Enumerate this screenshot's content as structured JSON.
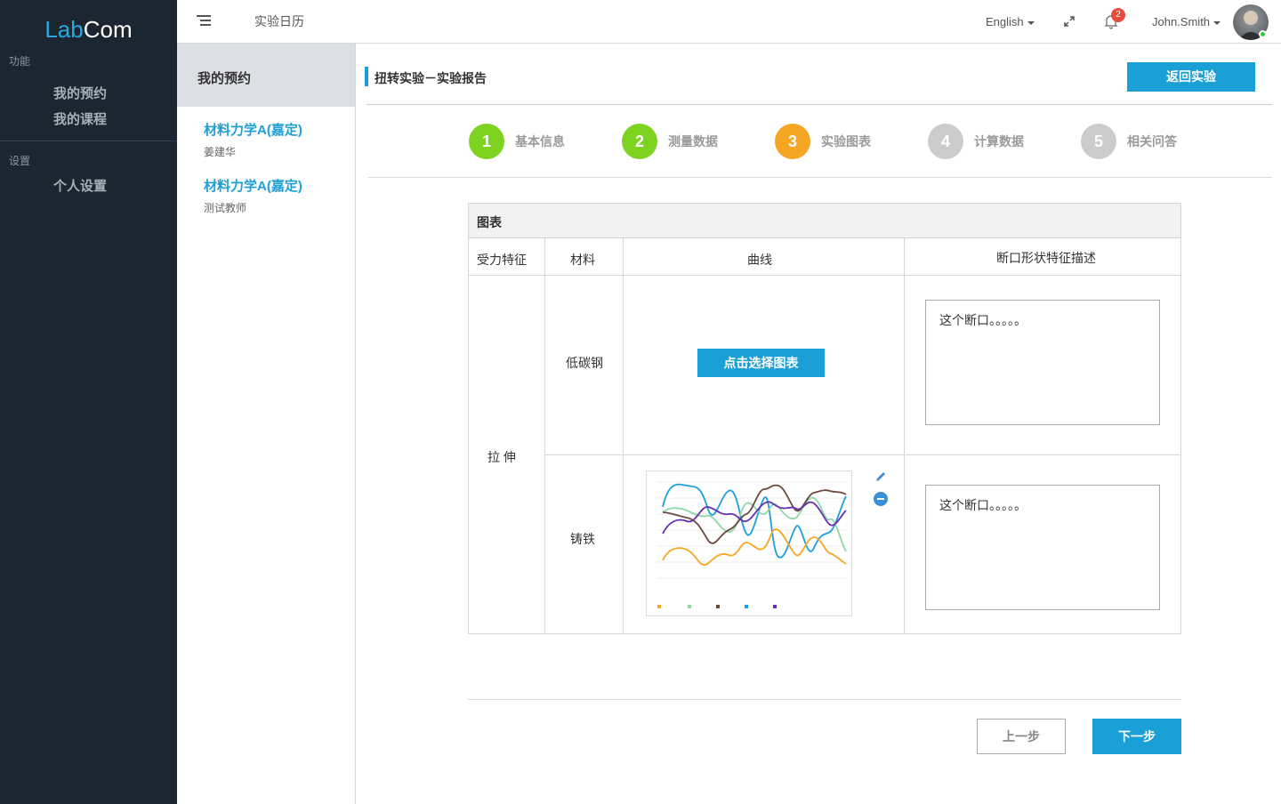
{
  "app": {
    "logo_lab": "Lab",
    "logo_com": "Com"
  },
  "sidebar": {
    "section_function": "功能",
    "items_function": [
      "我的预约",
      "我的课程"
    ],
    "section_settings": "设置",
    "items_settings": [
      "个人设置"
    ]
  },
  "topbar": {
    "calendar_link": "实验日历",
    "language": "English",
    "notification_count": "2",
    "username": "John.Smith"
  },
  "panel": {
    "header": "我的预约",
    "courses": [
      {
        "title": "材料力学A(嘉定)",
        "teacher": "姜建华"
      },
      {
        "title": "材料力学A(嘉定)",
        "teacher": "测试教师"
      }
    ]
  },
  "main": {
    "title": "扭转实验－实验报告",
    "back_button": "返回实验",
    "steps": [
      {
        "num": "1",
        "label": "基本信息",
        "color": "#7ed321"
      },
      {
        "num": "2",
        "label": "测量数据",
        "color": "#7ed321"
      },
      {
        "num": "3",
        "label": "实验图表",
        "color": "#f5a623"
      },
      {
        "num": "4",
        "label": "计算数据",
        "color": "#cccccc"
      },
      {
        "num": "5",
        "label": "相关问答",
        "color": "#cccccc"
      }
    ],
    "table": {
      "caption": "图表",
      "headers": [
        "受力特征",
        "材料",
        "曲线",
        "断口形状特征描述"
      ],
      "force": "拉 伸",
      "rows": [
        {
          "material": "低碳钢",
          "chart_button": "点击选择图表",
          "description": "这个断口。。。。。"
        },
        {
          "material": "铸铁",
          "description": "这个断口。。。。。"
        }
      ]
    },
    "prev_button": "上一步",
    "next_button": "下一步"
  },
  "colors": {
    "accent": "#1a9fd6",
    "sidebar_bg": "#1b2631",
    "step_done": "#7ed321",
    "step_active": "#f5a623",
    "step_todo": "#cccccc"
  }
}
